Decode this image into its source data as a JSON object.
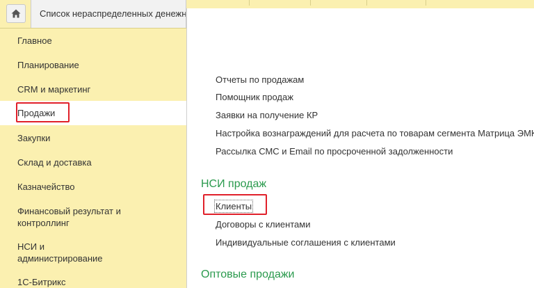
{
  "tab": {
    "title": "Список нераспределенных денежных средств"
  },
  "sidebar": {
    "items": [
      {
        "label": "Главное"
      },
      {
        "label": "Планирование"
      },
      {
        "label": "CRM и маркетинг"
      },
      {
        "label": "Продажи"
      },
      {
        "label": "Закупки"
      },
      {
        "label": "Склад и доставка"
      },
      {
        "label": "Казначейство"
      },
      {
        "label": "Финансовый результат и контроллинг"
      },
      {
        "label": "НСИ и администрирование"
      },
      {
        "label": "1С-Битрикс"
      }
    ]
  },
  "panel": {
    "sales_items": [
      {
        "label": "Отчеты по продажам"
      },
      {
        "label": "Помощник продаж"
      },
      {
        "label": "Заявки на получение КР"
      },
      {
        "label": "Настройка вознаграждений для расчета по товарам сегмента Матрица ЭМК"
      },
      {
        "label": "Рассылка СМС и Email по просроченной задолженности"
      }
    ],
    "nsi_group": {
      "title": "НСИ продаж",
      "items": [
        {
          "label": "Клиенты"
        },
        {
          "label": "Договоры с клиентами"
        },
        {
          "label": "Индивидуальные соглашения с клиентами"
        }
      ]
    },
    "wholesale_group": {
      "title": "Оптовые продажи"
    }
  },
  "colors": {
    "sidebar_bg": "#fbf0b0",
    "group_title": "#2a9a4d",
    "highlight": "#e0202a"
  }
}
